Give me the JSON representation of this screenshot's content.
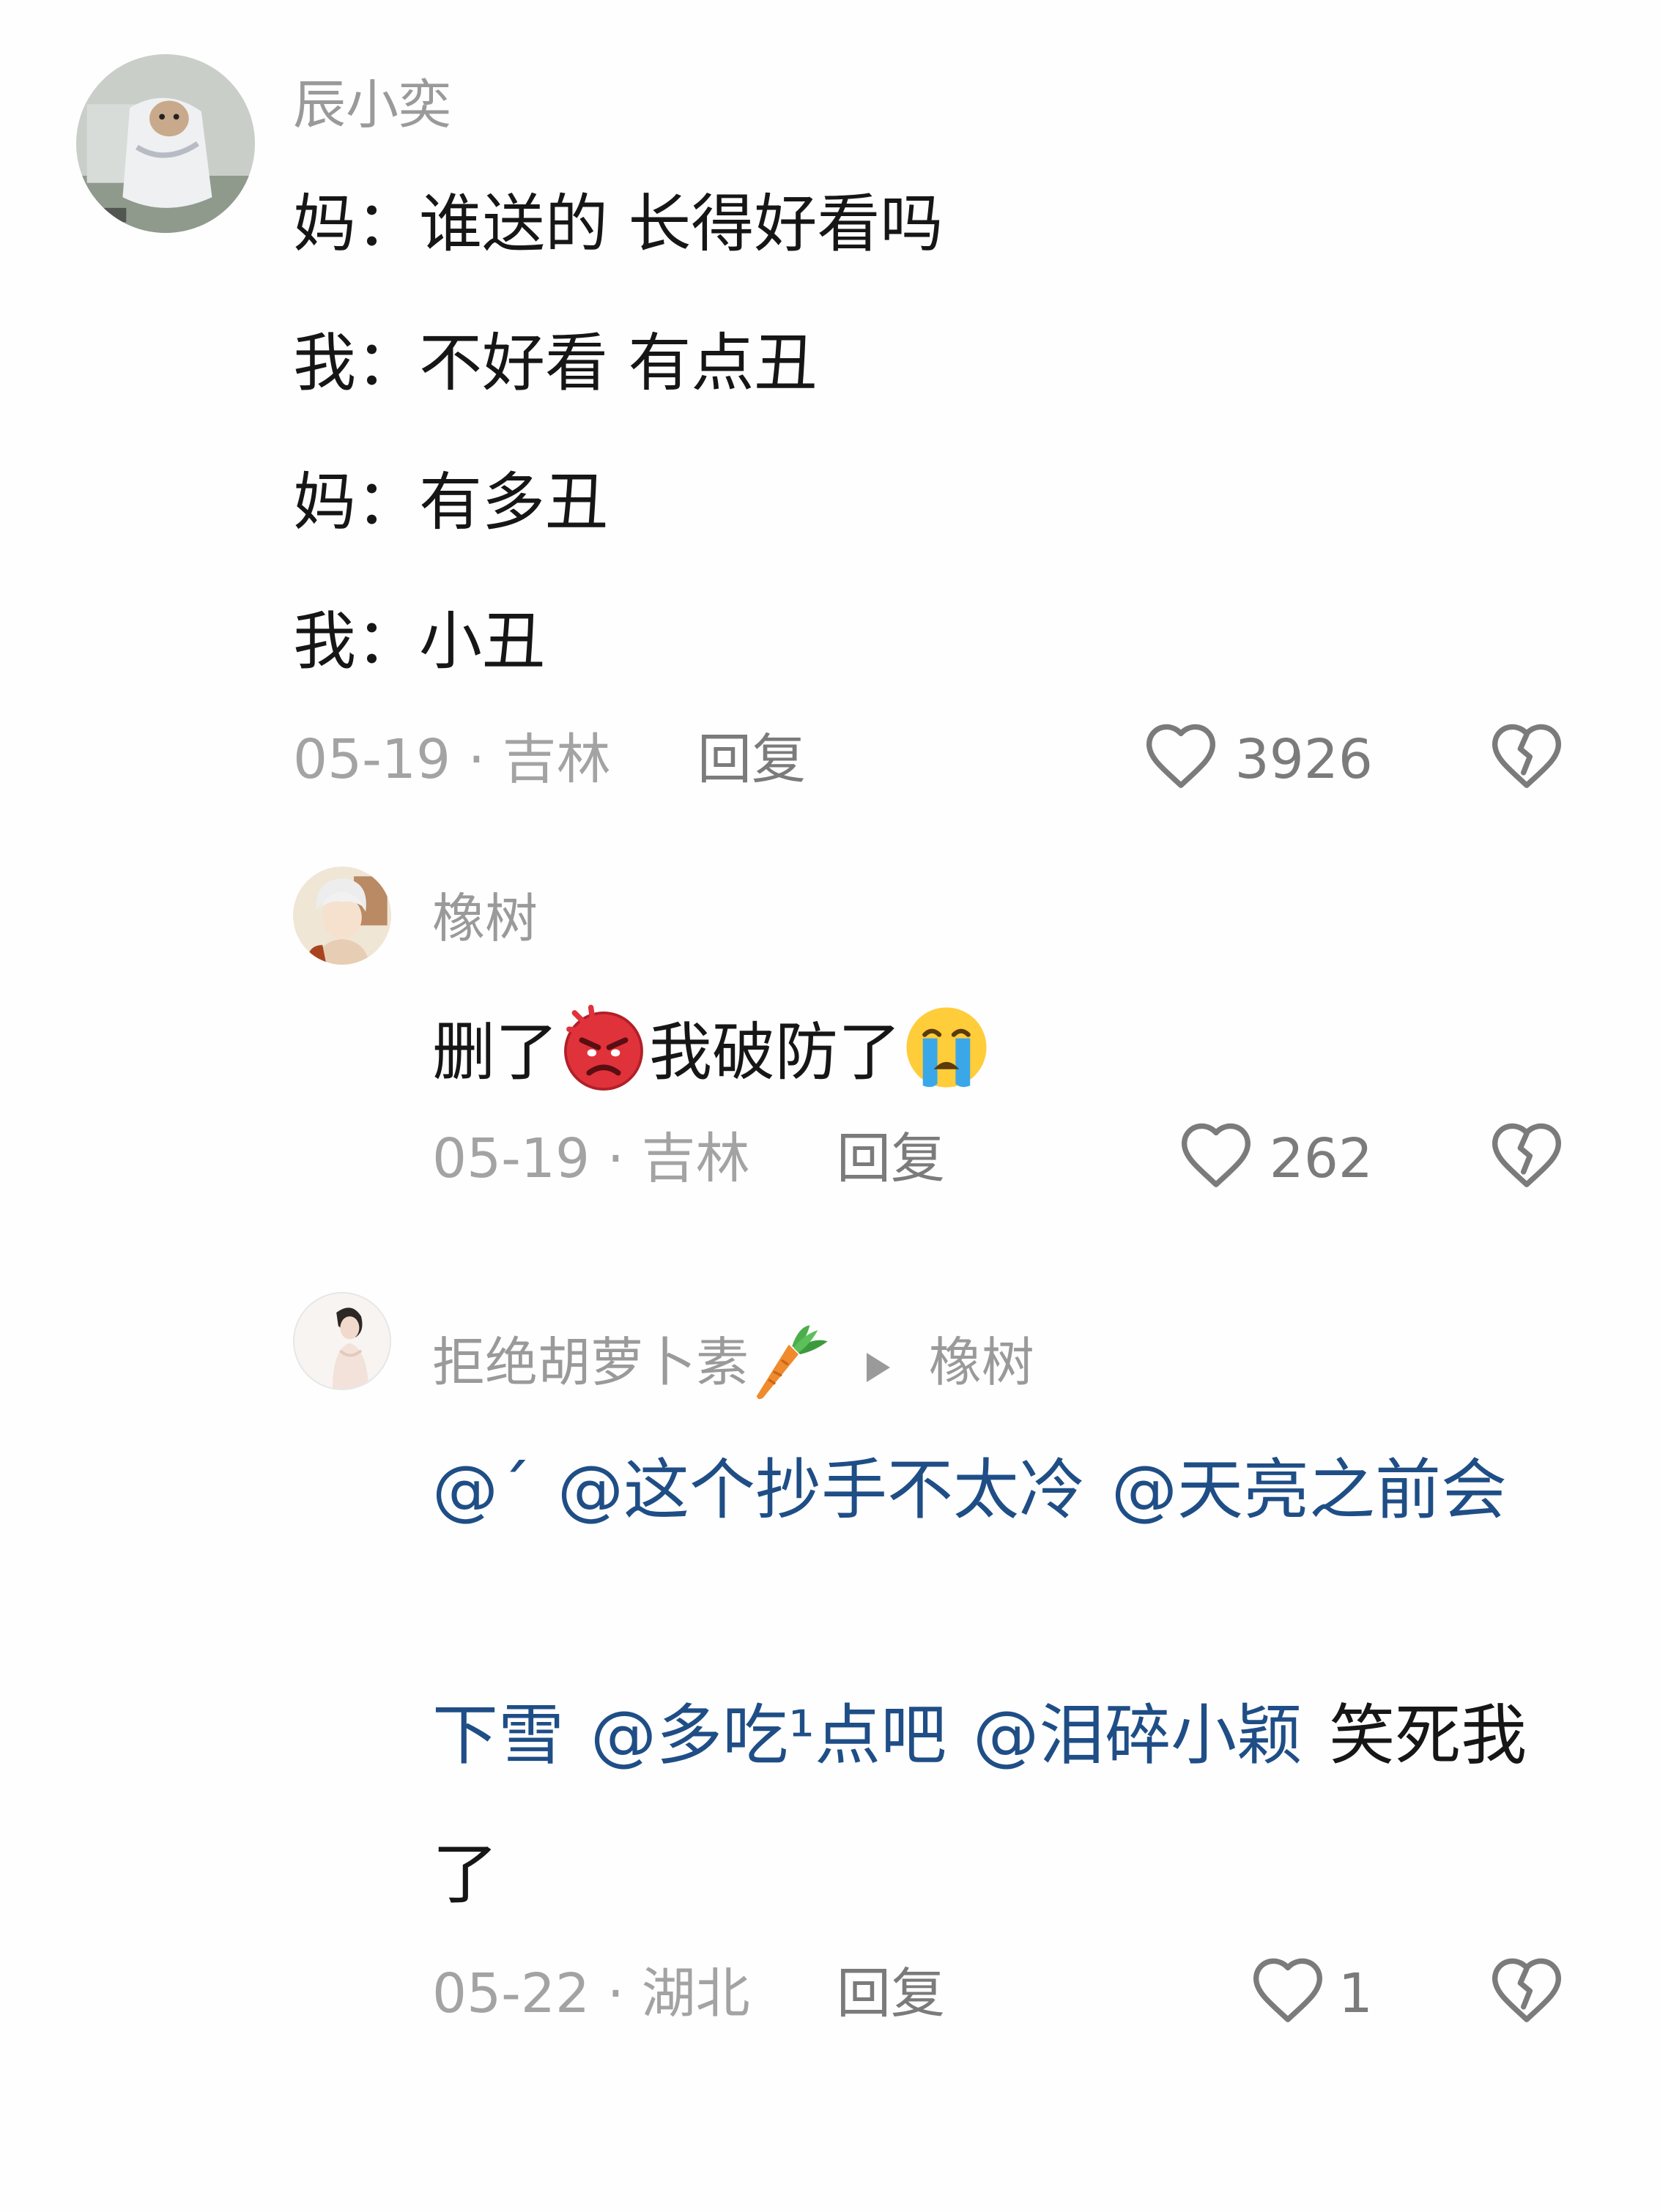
{
  "comments": [
    {
      "user": "辰小奕",
      "lines": [
        "妈：谁送的  长得好看吗",
        "我：不好看  有点丑",
        "妈：有多丑",
        "我：小丑"
      ],
      "date": "05-19",
      "location": "吉林",
      "meta_separator": "·",
      "reply_label": "回复",
      "likes": "3926"
    },
    {
      "user": "橡树",
      "text_parts": [
        "删了",
        "我破防了"
      ],
      "emojis": [
        "angry-face-emoji",
        "crying-face-emoji"
      ],
      "date": "05-19",
      "location": "吉林",
      "meta_separator": "·",
      "reply_label": "回复",
      "likes": "262"
    },
    {
      "user": "拒绝胡萝卜素",
      "user_emoji": "carrot-emoji",
      "reply_to": "橡树",
      "line1": {
        "m1": "@",
        "m2": "@这个抄手不太冷",
        "m3": "@天亮之前会"
      },
      "line2": {
        "m1": "下雪",
        "m2": "@多吃¹点吧",
        "m3": "@泪碎小颖",
        "tail": "笑死我"
      },
      "line3": "了",
      "date": "05-22",
      "location": "湖北",
      "meta_separator": "·",
      "reply_label": "回复",
      "likes": "1"
    }
  ],
  "colors": {
    "mention": "#1f4e86",
    "meta": "#a3a3a3",
    "username": "#9a9a9a"
  }
}
